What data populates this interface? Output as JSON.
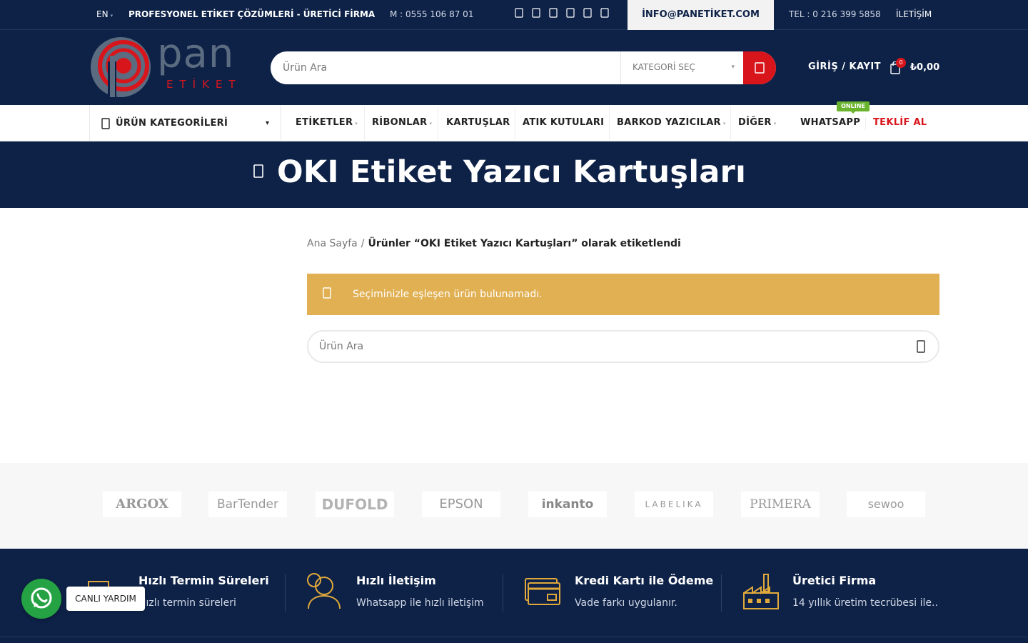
{
  "topbar": {
    "lang": "EN",
    "tagline": "PROFESYONEL ETİKET ÇÖZÜMLERİ - ÜRETİCİ FİRMA",
    "mobile": "M : 0555 106 87 01",
    "email": "İNFO@PANETİKET.COM",
    "phone": "TEL : 0 216 399 5858",
    "contact": "İLETİŞİM",
    "socials": [
      "facebook-icon",
      "twitter-icon",
      "instagram-icon",
      "youtube-icon",
      "linkedin-icon",
      "pinterest-icon"
    ]
  },
  "header": {
    "logo_text": "pan",
    "logo_sub": "ETİKET",
    "search_placeholder": "Ürün Ara",
    "category_select": "KATEGORİ SEÇ",
    "login": "GİRİŞ / KAYIT",
    "cart_count": "0",
    "cart_total": "₺0,00"
  },
  "nav": {
    "categories": "ÜRÜN KATEGORİLERİ",
    "items": [
      "ETİKETLER",
      "RİBONLAR",
      "KARTUŞLAR",
      "ATIK KUTULARI",
      "BARKOD YAZICILAR",
      "DİĞER"
    ],
    "whatsapp": "WHATSAPP",
    "online_badge": "ONLINE",
    "quote": "TEKLİF AL"
  },
  "hero": {
    "title": "OKI Etiket Yazıcı Kartuşları"
  },
  "breadcrumb": {
    "home": "Ana Sayfa",
    "separator": "/",
    "current": "Ürünler “OKI Etiket Yazıcı Kartuşları” olarak etiketlendi"
  },
  "notice": {
    "message": "Seçiminizle eşleşen ürün bulunamadı."
  },
  "search2": {
    "placeholder": "Ürün Ara"
  },
  "brands": [
    "ARGOX",
    "BarTender",
    "DUFOLD",
    "EPSON",
    "inkanto",
    "LABELIKA",
    "PRIMERA",
    "sewoo"
  ],
  "features": [
    {
      "title": "Hızlı Termin Süreleri",
      "sub": "Hızlı termin süreleri"
    },
    {
      "title": "Hızlı İletişim",
      "sub": "Whatsapp ile hızlı iletişim"
    },
    {
      "title": "Kredi Kartı ile Ödeme",
      "sub": "Vade farkı uygulanır."
    },
    {
      "title": "Üretici Firma",
      "sub": "14 yıllık üretim tecrübesi ile.."
    }
  ],
  "whatsapp_widget": {
    "label": "CANLI YARDIM"
  },
  "colors": {
    "navy": "#0e2248",
    "red": "#d9151c",
    "notice": "#e0b052",
    "online": "#6ab42d",
    "whatsapp": "#25a244",
    "feature_icon": "#e0a93a"
  }
}
